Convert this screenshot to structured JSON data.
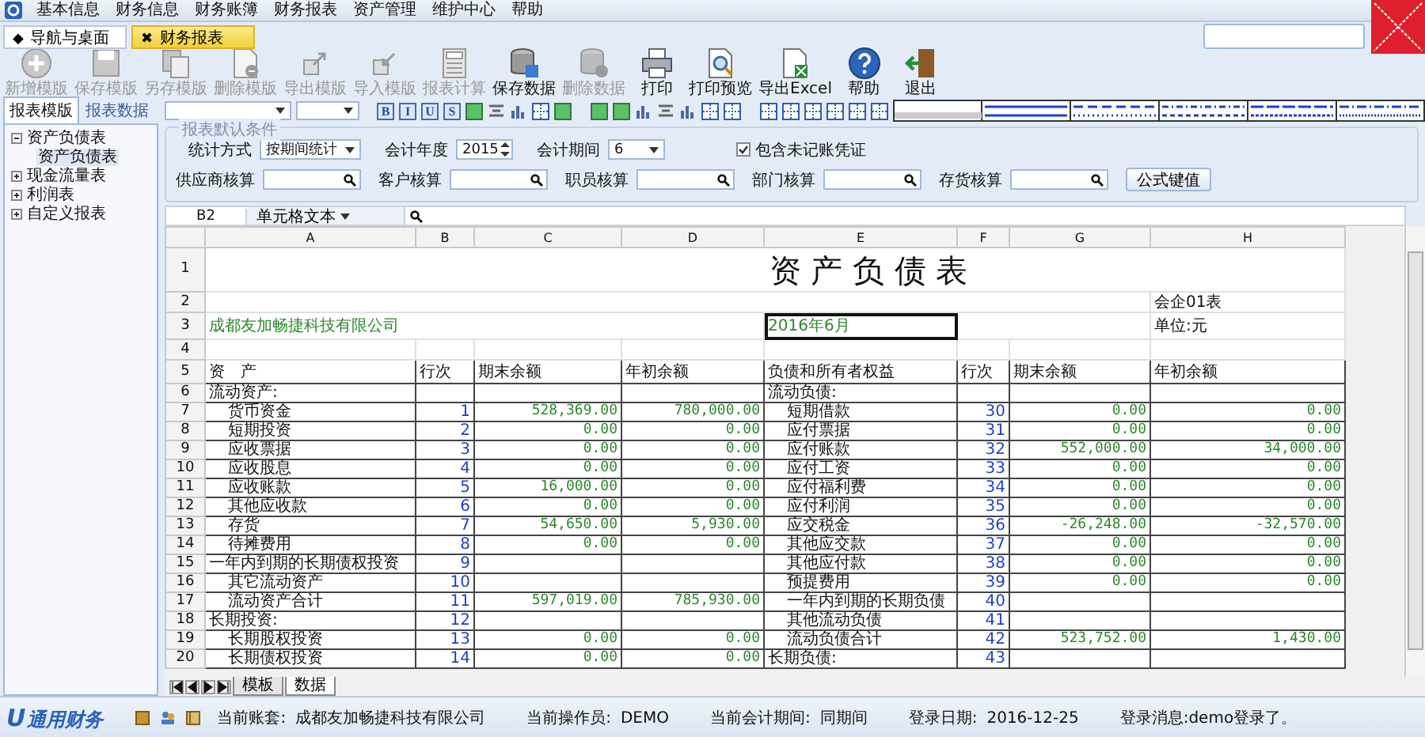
{
  "menu": [
    "基本信息",
    "财务信息",
    "财务账簿",
    "财务报表",
    "资产管理",
    "维护中心",
    "帮助"
  ],
  "tabs": [
    {
      "icon": "◆",
      "label": "导航与桌面",
      "selected": false
    },
    {
      "icon": "✖",
      "label": "财务报表",
      "selected": true
    }
  ],
  "toolbar": [
    {
      "kind": "add",
      "label": "新增模版",
      "disabled": true
    },
    {
      "kind": "disk",
      "label": "保存模版",
      "disabled": true
    },
    {
      "kind": "copy",
      "label": "另存模版",
      "disabled": true
    },
    {
      "kind": "docminus",
      "label": "删除模版",
      "disabled": true
    },
    {
      "kind": "export",
      "label": "导出模版",
      "disabled": true
    },
    {
      "kind": "import",
      "label": "导入模版",
      "disabled": true
    },
    {
      "kind": "calculator",
      "label": "报表计算",
      "disabled": true
    },
    {
      "kind": "database",
      "label": "保存数据",
      "disabled": false
    },
    {
      "kind": "dbminus",
      "label": "删除数据",
      "disabled": true
    },
    {
      "kind": "printer",
      "label": "打印",
      "disabled": false
    },
    {
      "kind": "preview",
      "label": "打印预览",
      "disabled": false
    },
    {
      "kind": "excel",
      "label": "导出Excel",
      "disabled": false
    },
    {
      "kind": "help",
      "label": "帮助",
      "disabled": false
    },
    {
      "kind": "exit",
      "label": "退出",
      "disabled": false
    }
  ],
  "left_tabs": [
    {
      "label": "报表模版",
      "selected": true
    },
    {
      "label": "报表数据",
      "selected": false
    }
  ],
  "tree": [
    {
      "label": "资产负债表",
      "expanded": true,
      "children": [
        {
          "label": "资产负债表",
          "selected": true
        }
      ]
    },
    {
      "label": "现金流量表",
      "expanded": false
    },
    {
      "label": "利润表",
      "expanded": false
    },
    {
      "label": "自定义报表",
      "expanded": false
    }
  ],
  "format_letters": [
    "B",
    "I",
    "U",
    "S"
  ],
  "filter": {
    "legend": "报表默认条件",
    "fields": [
      {
        "kind": "select",
        "label": "统计方式",
        "value": "按期间统计"
      },
      {
        "kind": "spin",
        "label": "会计年度",
        "value": "2015"
      },
      {
        "kind": "select",
        "label": "会计期间",
        "value": "6"
      }
    ],
    "checkbox": {
      "label": "包含未记账凭证",
      "checked": true
    },
    "search_fields": [
      "供应商核算",
      "客户核算",
      "职员核算",
      "部门核算",
      "存货核算"
    ],
    "button": "公式键值"
  },
  "formula_bar": {
    "cell": "B2",
    "mode": "单元格文本"
  },
  "sheet": {
    "columns": [
      "A",
      "B",
      "C",
      "D",
      "E",
      "F",
      "G",
      "H"
    ],
    "top_row_numbers": [
      "1",
      "2",
      "3",
      "4",
      "5"
    ],
    "title": "资 产 负 债 表",
    "form_no": "会企01表",
    "company": "成都友加畅捷科技有限公司",
    "period": "2016年6月",
    "period_selected": true,
    "unit": "单位:元",
    "headers": [
      "资　产",
      "行次",
      "期末余额",
      "年初余额",
      "负债和所有者权益",
      "行次",
      "期末余额",
      "年初余额"
    ],
    "rows": [
      {
        "n": "6",
        "a": "流动资产:",
        "e": "流动负债:"
      },
      {
        "n": "7",
        "a": "货币资金",
        "a_indent": true,
        "b": "1",
        "c": "528,369.00",
        "d": "780,000.00",
        "e": "短期借款",
        "e_indent": true,
        "f": "30",
        "g": "0.00",
        "h": "0.00"
      },
      {
        "n": "8",
        "a": "短期投资",
        "a_indent": true,
        "b": "2",
        "c": "0.00",
        "d": "0.00",
        "e": "应付票据",
        "e_indent": true,
        "f": "31",
        "g": "0.00",
        "h": "0.00"
      },
      {
        "n": "9",
        "a": "应收票据",
        "a_indent": true,
        "b": "3",
        "c": "0.00",
        "d": "0.00",
        "e": "应付账款",
        "e_indent": true,
        "f": "32",
        "g": "552,000.00",
        "h": "34,000.00"
      },
      {
        "n": "10",
        "a": "应收股息",
        "a_indent": true,
        "b": "4",
        "c": "0.00",
        "d": "0.00",
        "e": "应付工资",
        "e_indent": true,
        "f": "33",
        "g": "0.00",
        "h": "0.00"
      },
      {
        "n": "11",
        "a": "应收账款",
        "a_indent": true,
        "b": "5",
        "c": "16,000.00",
        "d": "0.00",
        "e": "应付福利费",
        "e_indent": true,
        "f": "34",
        "g": "0.00",
        "h": "0.00"
      },
      {
        "n": "12",
        "a": "其他应收款",
        "a_indent": true,
        "b": "6",
        "c": "0.00",
        "d": "0.00",
        "e": "应付利润",
        "e_indent": true,
        "f": "35",
        "g": "0.00",
        "h": "0.00"
      },
      {
        "n": "13",
        "a": "存货",
        "a_indent": true,
        "b": "7",
        "c": "54,650.00",
        "d": "5,930.00",
        "e": "应交税金",
        "e_indent": true,
        "f": "36",
        "g": "-26,248.00",
        "h": "-32,570.00"
      },
      {
        "n": "14",
        "a": "待摊费用",
        "a_indent": true,
        "b": "8",
        "c": "0.00",
        "d": "0.00",
        "e": "其他应交款",
        "e_indent": true,
        "f": "37",
        "g": "0.00",
        "h": "0.00"
      },
      {
        "n": "15",
        "a": "一年内到期的长期债权投资",
        "b": "9",
        "e": "其他应付款",
        "e_indent": true,
        "f": "38",
        "g": "0.00",
        "h": "0.00"
      },
      {
        "n": "16",
        "a": "其它流动资产",
        "a_indent": true,
        "b": "10",
        "e": "预提费用",
        "e_indent": true,
        "f": "39",
        "g": "0.00",
        "h": "0.00"
      },
      {
        "n": "17",
        "a": "流动资产合计",
        "a_indent": true,
        "b": "11",
        "c": "597,019.00",
        "d": "785,930.00",
        "e": "一年内到期的长期负债",
        "e_indent": true,
        "f": "40"
      },
      {
        "n": "18",
        "a": "长期投资:",
        "b": "12",
        "e": "其他流动负债",
        "e_indent": true,
        "f": "41"
      },
      {
        "n": "19",
        "a": "长期股权投资",
        "a_indent": true,
        "b": "13",
        "c": "0.00",
        "d": "0.00",
        "e": "流动负债合计",
        "e_indent": true,
        "f": "42",
        "g": "523,752.00",
        "h": "1,430.00"
      },
      {
        "n": "20",
        "a": "长期债权投资",
        "a_indent": true,
        "b": "14",
        "c": "0.00",
        "d": "0.00",
        "e": "长期负债:",
        "f": "43"
      }
    ]
  },
  "sheet_tabs": [
    {
      "label": "模板",
      "selected": false
    },
    {
      "label": "数据",
      "selected": true
    }
  ],
  "status": {
    "logo_mark": "U",
    "logo": "通用财务",
    "items": [
      {
        "label": "当前账套:",
        "value": "成都友加畅捷科技有限公司"
      },
      {
        "label": "当前操作员:",
        "value": "DEMO"
      },
      {
        "label": "当前会计期间:",
        "value": "同期间"
      },
      {
        "label": "登录日期:",
        "value": "2016-12-25"
      }
    ],
    "message": "登录消息:demo登录了。"
  }
}
